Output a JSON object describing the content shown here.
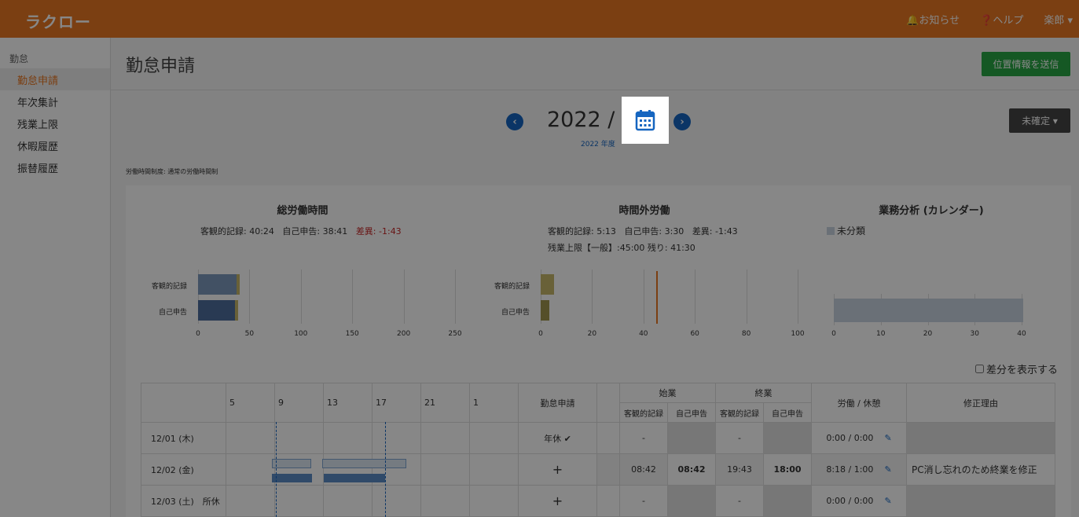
{
  "app": {
    "logo": "ラクロー"
  },
  "header": {
    "notice": "🔔お知らせ",
    "help": "❓ヘルプ",
    "user": "楽郎 ▾"
  },
  "sidebar": {
    "section": "勤怠",
    "items": [
      {
        "label": "勤怠申請",
        "active": true
      },
      {
        "label": "年次集計"
      },
      {
        "label": "残業上限"
      },
      {
        "label": "休暇履歴"
      },
      {
        "label": "振替履歴"
      }
    ]
  },
  "page": {
    "title": "勤怠申請",
    "location_button": "位置情報を送信",
    "month": "2022 / 12",
    "fiscal_year": "2022 年度",
    "status": "未確定 ▾",
    "work_system": "労働時間制度: 通常の労働時間制",
    "diff_checkbox": "差分を表示する"
  },
  "summary": {
    "total": {
      "title": "総労働時間",
      "objective": "客観的記録: 40:24",
      "self": "自己申告: 38:41",
      "diff": "差異: -1:43"
    },
    "overtime": {
      "title": "時間外労働",
      "objective": "客観的記録: 5:13",
      "self": "自己申告: 3:30",
      "diff": "差異: -1:43",
      "limit": "残業上限【一般】:45:00 残り: 41:30"
    },
    "analysis": {
      "title": "業務分析 (カレンダー)",
      "legend": "未分類"
    }
  },
  "chart_data": [
    {
      "type": "bar",
      "title": "総労働時間",
      "categories": [
        "客観的記録",
        "自己申告"
      ],
      "series": [
        {
          "values": [
            40.4,
            38.7
          ]
        }
      ],
      "xlim": [
        0,
        250
      ],
      "xticks": [
        0,
        50,
        100,
        150,
        200,
        250
      ]
    },
    {
      "type": "bar",
      "title": "時間外労働",
      "categories": [
        "客観的記録",
        "自己申告"
      ],
      "series": [
        {
          "values": [
            5.2,
            3.5
          ]
        }
      ],
      "xlim": [
        0,
        100
      ],
      "xticks": [
        0,
        20,
        40,
        60,
        80,
        100
      ],
      "limit_line": 45
    },
    {
      "type": "bar",
      "title": "業務分析 (カレンダー)",
      "series": [
        {
          "name": "未分類",
          "values": [
            40.4
          ]
        }
      ],
      "xlim": [
        0,
        40
      ],
      "xticks": [
        0,
        10,
        20,
        30,
        40
      ]
    }
  ],
  "table": {
    "hours": [
      "5",
      "9",
      "13",
      "17",
      "21",
      "1"
    ],
    "col_apply": "勤怠申請",
    "col_start": "始業",
    "col_end": "終業",
    "col_obj": "客観的記録",
    "col_self": "自己申告",
    "col_work": "労働 / 休憩",
    "col_reason": "修正理由",
    "rows": [
      {
        "date": "12/01 (木)",
        "apply": "年休 ✔",
        "start_obj": "-",
        "start_self": "",
        "end_obj": "-",
        "end_self": "",
        "work": "0:00 / 0:00",
        "reason": ""
      },
      {
        "date": "12/02 (金)",
        "apply": "+",
        "start_obj": "08:42",
        "start_self": "08:42",
        "end_obj": "19:43",
        "end_self": "18:00",
        "work": "8:18 / 1:00",
        "reason": "PC消し忘れのため終業を修正"
      },
      {
        "date": "12/03 (土)　所休",
        "apply": "+",
        "start_obj": "-",
        "start_self": "",
        "end_obj": "-",
        "end_self": "",
        "work": "0:00 / 0:00",
        "reason": ""
      }
    ]
  }
}
